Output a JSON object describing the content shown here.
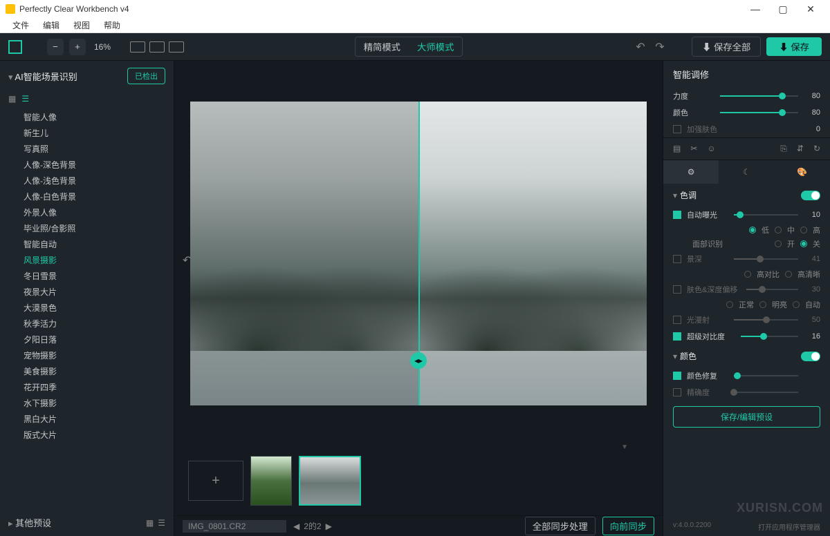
{
  "window": {
    "title": "Perfectly Clear Workbench v4"
  },
  "menubar": {
    "file": "文件",
    "edit": "编辑",
    "view": "视图",
    "help": "帮助"
  },
  "toolbar": {
    "zoom_pct": "16%",
    "mode_simple": "精简模式",
    "mode_master": "大师模式",
    "save_all": "⬇ 保存全部",
    "save": "⬇ 保存"
  },
  "left": {
    "title": "AI智能场景识别",
    "detect_btn": "已检出",
    "presets": [
      "智能人像",
      "新生儿",
      "写真照",
      "人像-深色背景",
      "人像-浅色背景",
      "人像-白色背景",
      "外景人像",
      "毕业照/合影照",
      "智能自动",
      "风景摄影",
      "冬日雪景",
      "夜景大片",
      "大漠景色",
      "秋季活力",
      "夕阳日落",
      "宠物摄影",
      "美食摄影",
      "花开四季",
      "水下摄影",
      "黑白大片",
      "版式大片"
    ],
    "active_preset_index": 9,
    "other_title": "其他预设"
  },
  "bottom": {
    "filename": "IMG_0801.CR2",
    "page_info": "2的2",
    "sync_all": "全部同步处理",
    "sync_forward": "向前同步"
  },
  "right": {
    "smart_title": "智能调修",
    "strength_label": "力度",
    "strength_val": "80",
    "color_label": "颜色",
    "color_val": "80",
    "enhance_skin_label": "加强肤色",
    "enhance_skin_val": "0",
    "section_tone": "色调",
    "auto_expo_label": "自动曝光",
    "auto_expo_val": "10",
    "radio_low": "低",
    "radio_mid": "中",
    "radio_high": "高",
    "face_detect_label": "面部识别",
    "radio_on": "开",
    "radio_off": "关",
    "depth_label": "景深",
    "depth_val": "41",
    "radio_highcontrast": "高对比",
    "radio_highclear": "高清晰",
    "skin_depth_label": "肤色&深度偏移",
    "skin_depth_val": "30",
    "radio_normal": "正常",
    "radio_bright": "明亮",
    "radio_auto": "自动",
    "diffuse_label": "光漫射",
    "diffuse_val": "50",
    "super_contrast_label": "超级对比度",
    "super_contrast_val": "16",
    "section_color": "颜色",
    "color_restore_label": "颜色修复",
    "accuracy_label": "精确度",
    "save_preset": "保存/编辑预设",
    "version": "v:4.0.0.2200",
    "open_mgr": "打开应用程序管理器"
  },
  "watermark": "XURISN.COM"
}
